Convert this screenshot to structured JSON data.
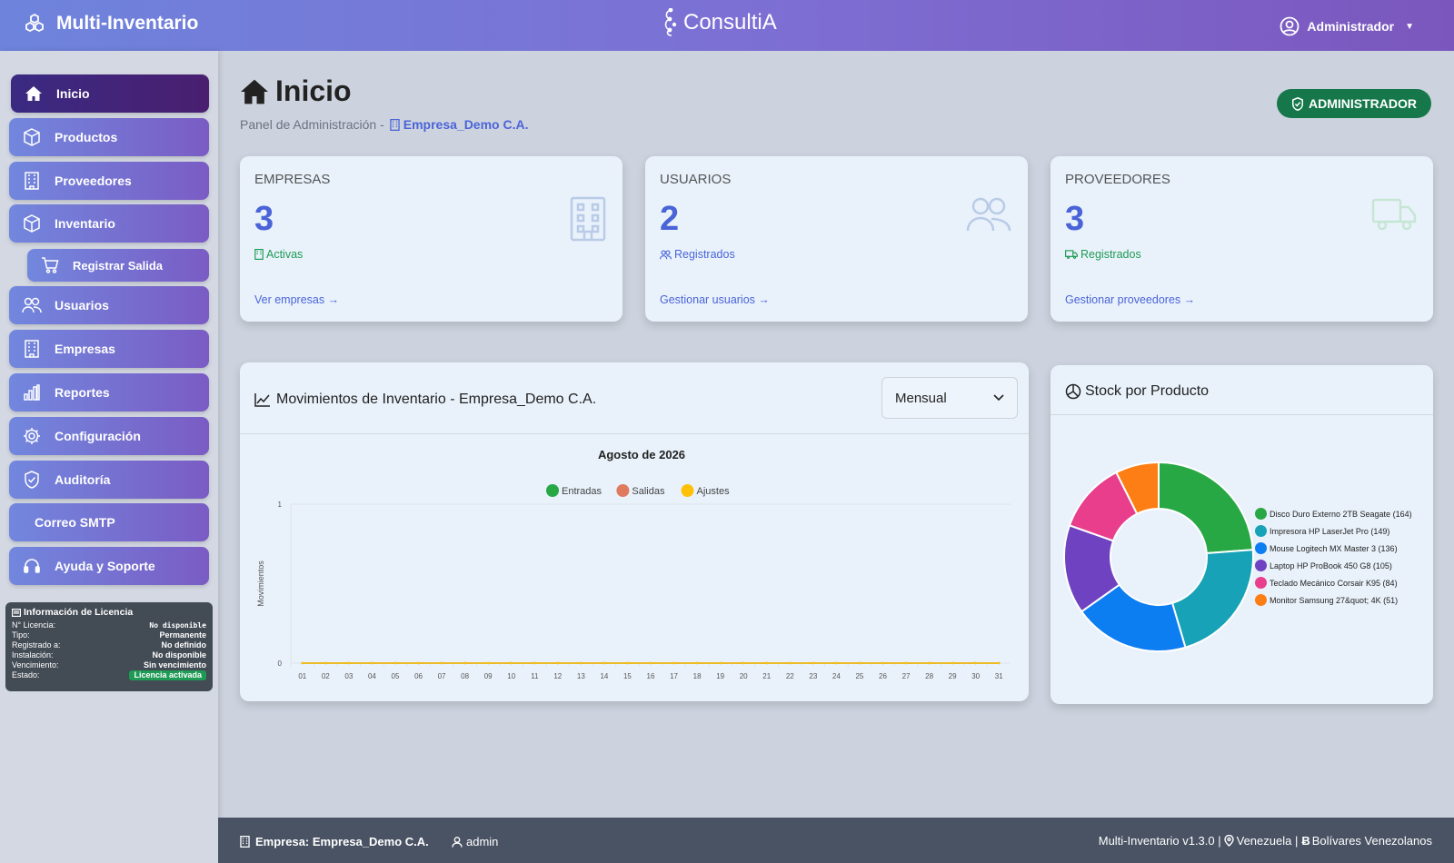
{
  "app": {
    "name": "Multi-Inventario",
    "logo_text": "ConsultiA",
    "user": "Administrador"
  },
  "sidebar": {
    "items": [
      {
        "label": "Inicio",
        "icon": "home-icon",
        "active": true
      },
      {
        "label": "Productos",
        "icon": "box-icon"
      },
      {
        "label": "Proveedores",
        "icon": "building-icon"
      },
      {
        "label": "Inventario",
        "icon": "box-icon"
      },
      {
        "label": "Registrar Salida",
        "icon": "cart-icon",
        "sub": true
      },
      {
        "label": "Usuarios",
        "icon": "users-icon"
      },
      {
        "label": "Empresas",
        "icon": "building-icon"
      },
      {
        "label": "Reportes",
        "icon": "bar-chart-icon"
      },
      {
        "label": "Configuración",
        "icon": "gear-icon"
      },
      {
        "label": "Auditoría",
        "icon": "shield-icon"
      },
      {
        "label": "Correo SMTP",
        "icon": ""
      },
      {
        "label": "Ayuda y Soporte",
        "icon": "headset-icon"
      }
    ]
  },
  "license": {
    "title": "Información de Licencia",
    "rows": [
      {
        "k": "N° Licencia:",
        "v": "No disponible"
      },
      {
        "k": "Tipo:",
        "v": "Permanente"
      },
      {
        "k": "Registrado a:",
        "v": "No definido"
      },
      {
        "k": "Instalación:",
        "v": "No disponible"
      },
      {
        "k": "Vencimiento:",
        "v": "Sin vencimiento"
      },
      {
        "k": "Estado:",
        "v": "Licencia activada"
      }
    ]
  },
  "header": {
    "title": "Inicio",
    "subtitle_prefix": "Panel de Administración -",
    "company": "Empresa_Demo C.A.",
    "role_badge": "ADMINISTRADOR"
  },
  "stats": [
    {
      "label": "EMPRESAS",
      "value": "3",
      "sub": "Activas",
      "link": "Ver empresas →",
      "sub_color": "#1f9a55"
    },
    {
      "label": "USUARIOS",
      "value": "2",
      "sub": "Registrados",
      "link": "Gestionar usuarios →",
      "sub_color": "#4a64d8"
    },
    {
      "label": "PROVEEDORES",
      "value": "3",
      "sub": "Registrados",
      "link": "Gestionar proveedores →",
      "sub_color": "#1f9a55"
    }
  ],
  "movements": {
    "title": "Movimientos de Inventario - Empresa_Demo C.A.",
    "period": "Mensual"
  },
  "chart_data": [
    {
      "type": "line",
      "title": "Agosto de 2026",
      "ylabel": "Movimientos",
      "xlabel": "",
      "x": [
        "01",
        "02",
        "03",
        "04",
        "05",
        "06",
        "07",
        "08",
        "09",
        "10",
        "11",
        "12",
        "13",
        "14",
        "15",
        "16",
        "17",
        "18",
        "19",
        "20",
        "21",
        "22",
        "23",
        "24",
        "25",
        "26",
        "27",
        "28",
        "29",
        "30",
        "31"
      ],
      "ylim": [
        0,
        1
      ],
      "yticks": [
        "0",
        "1"
      ],
      "grid": true,
      "legend": "top",
      "series": [
        {
          "name": "Entradas",
          "color": "#28a745",
          "values": [
            0,
            0,
            0,
            0,
            0,
            0,
            0,
            0,
            0,
            0,
            0,
            0,
            0,
            0,
            0,
            0,
            0,
            0,
            0,
            0,
            0,
            0,
            0,
            0,
            0,
            0,
            0,
            0,
            0,
            0,
            0
          ]
        },
        {
          "name": "Salidas",
          "color": "#e07a5f",
          "values": [
            0,
            0,
            0,
            0,
            0,
            0,
            0,
            0,
            0,
            0,
            0,
            0,
            0,
            0,
            0,
            0,
            0,
            0,
            0,
            0,
            0,
            0,
            0,
            0,
            0,
            0,
            0,
            0,
            0,
            0,
            0
          ]
        },
        {
          "name": "Ajustes",
          "color": "#ffc107",
          "values": [
            0,
            0,
            0,
            0,
            0,
            0,
            0,
            0,
            0,
            0,
            0,
            0,
            0,
            0,
            0,
            0,
            0,
            0,
            0,
            0,
            0,
            0,
            0,
            0,
            0,
            0,
            0,
            0,
            0,
            0,
            0
          ]
        }
      ]
    },
    {
      "type": "pie",
      "title": "Stock por Producto",
      "legend": "right",
      "slices": [
        {
          "label": "Disco Duro Externo 2TB Seagate (164)",
          "value": 164,
          "color": "#28a745"
        },
        {
          "label": "Impresora HP LaserJet Pro (149)",
          "value": 149,
          "color": "#17a2b8"
        },
        {
          "label": "Mouse Logitech MX Master 3 (136)",
          "value": 136,
          "color": "#0d7df2"
        },
        {
          "label": "Laptop HP ProBook 450 G8 (105)",
          "value": 105,
          "color": "#6f42c1"
        },
        {
          "label": "Teclado Mecánico Corsair K95 (84)",
          "value": 84,
          "color": "#e83e8c"
        },
        {
          "label": "Monitor Samsung 27&quot; 4K (51)",
          "value": 51,
          "color": "#fd7e14"
        }
      ]
    }
  ],
  "footer": {
    "company": "Empresa: Empresa_Demo C.A.",
    "user": "admin",
    "version": "Multi-Inventario v1.3.0 |",
    "country": "Venezuela |",
    "currency": "Bolívares Venezolanos"
  }
}
